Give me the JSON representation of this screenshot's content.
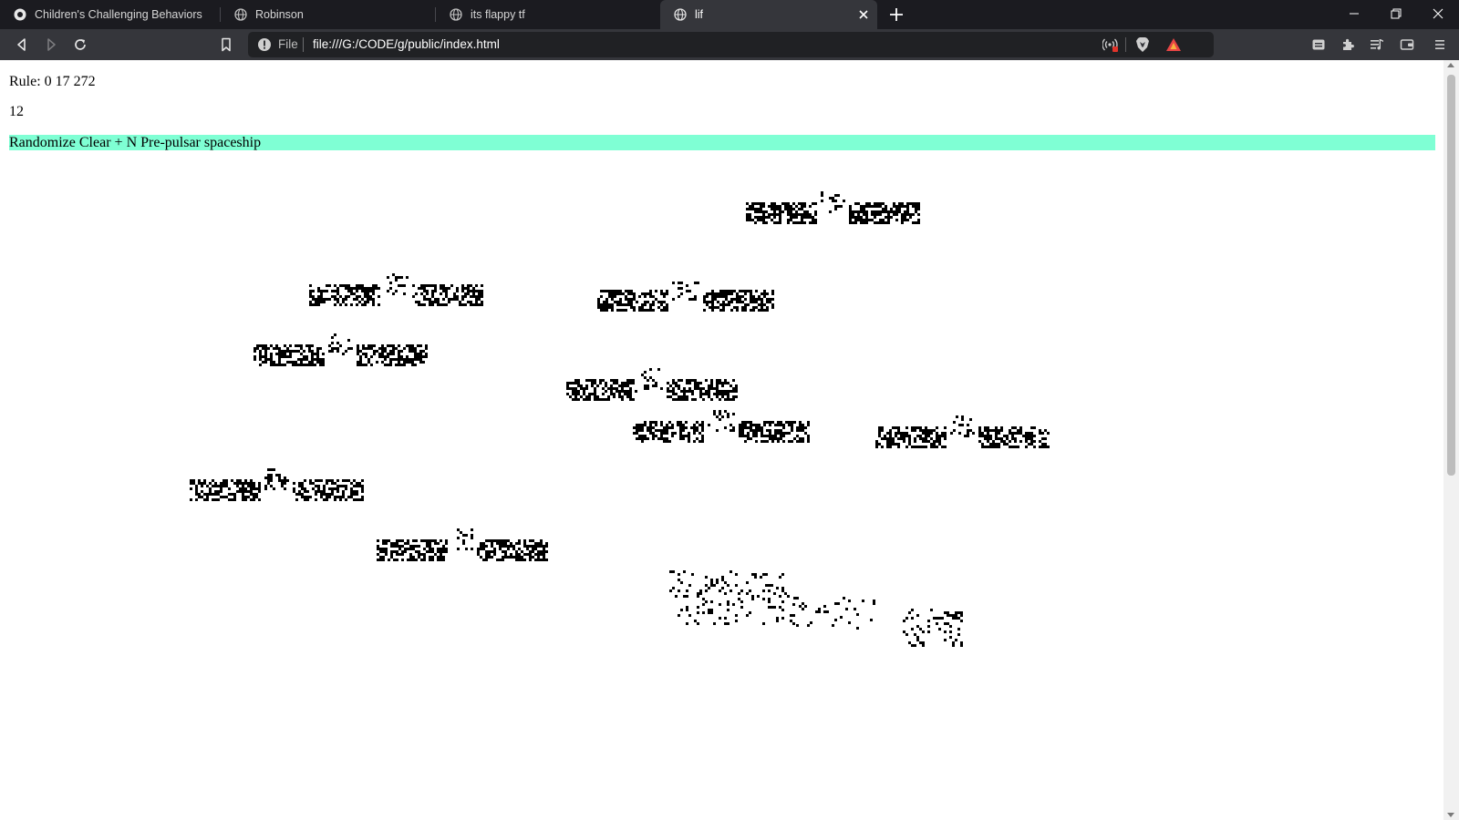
{
  "browser": {
    "tabs": [
      {
        "title": "Children's Challenging Behaviors",
        "icon": "site-icon"
      },
      {
        "title": "Robinson",
        "icon": "globe-icon"
      },
      {
        "title": "its flappy tf",
        "icon": "globe-icon"
      },
      {
        "title": "lif",
        "icon": "globe-icon",
        "active": true
      }
    ],
    "new_tab_icon": "plus-icon",
    "window_controls": [
      "minimize-icon",
      "restore-icon",
      "close-icon"
    ],
    "nav": [
      "back-icon",
      "forward-icon",
      "reload-icon",
      "bookmark-icon"
    ],
    "url": {
      "scheme_label": "File",
      "address": "file:///G:/CODE/g/public/index.html"
    },
    "right_icons": [
      "broadcast-icon",
      "brave-shield-icon",
      "brave-rewards-icon",
      "sidebar-icon",
      "extensions-icon",
      "playlist-icon",
      "wallet-icon",
      "menu-icon"
    ]
  },
  "app": {
    "rule_label": "Rule: 0 17 272",
    "generation": "12",
    "controls": {
      "randomize": "Randomize",
      "clear": "Clear",
      "plus": "+",
      "n": "N",
      "pattern": "Pre-pulsar spaceship"
    },
    "colors": {
      "controls_bg": "#7fffd4",
      "cell": "#000000",
      "background": "#ffffff"
    }
  }
}
